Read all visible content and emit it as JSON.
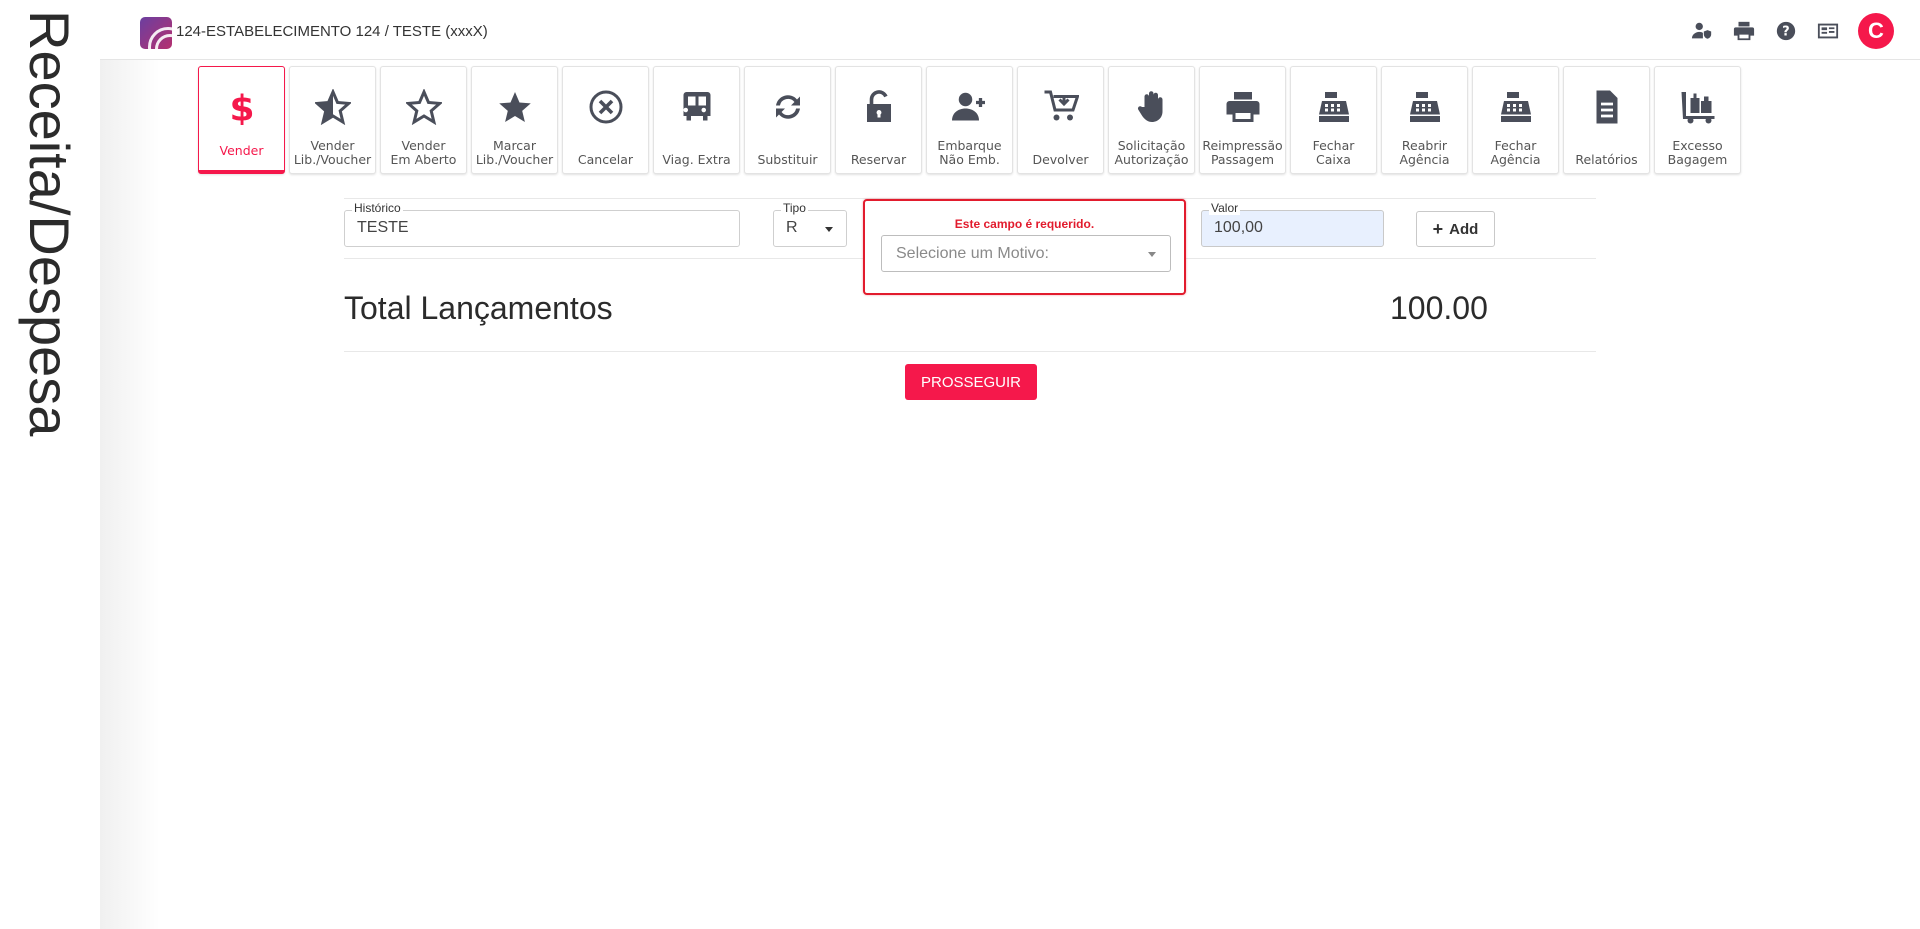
{
  "page": {
    "side_title": "Receita/Despesa"
  },
  "header": {
    "title": "124-ESTABELECIMENTO 124 / TESTE (xxxX)",
    "icons": [
      "user-shield-icon",
      "printer-icon",
      "help-icon",
      "cash-register-icon"
    ],
    "avatar_letter": "C",
    "accent_color": "#f5184b"
  },
  "toolbar": {
    "items": [
      {
        "label": "Vender",
        "icon": "dollar-icon",
        "active": true
      },
      {
        "label": "Vender\nLib./Voucher",
        "icon": "star-half-icon"
      },
      {
        "label": "Vender\nEm Aberto",
        "icon": "star-outline-icon"
      },
      {
        "label": "Marcar\nLib./Voucher",
        "icon": "star-icon"
      },
      {
        "label": "Cancelar",
        "icon": "cancel-circle-icon"
      },
      {
        "label": "Viag. Extra",
        "icon": "bus-icon"
      },
      {
        "label": "Substituir",
        "icon": "sync-icon"
      },
      {
        "label": "Reservar",
        "icon": "unlock-icon"
      },
      {
        "label": "Embarque\nNão Emb.",
        "icon": "user-plus-icon"
      },
      {
        "label": "Devolver",
        "icon": "cart-return-icon"
      },
      {
        "label": "Solicitação\nAutorização",
        "icon": "hand-icon"
      },
      {
        "label": "Reimpressão\nPassagem",
        "icon": "printer-icon"
      },
      {
        "label": "Fechar\nCaixa",
        "icon": "cash-register-icon"
      },
      {
        "label": "Reabrir\nAgência",
        "icon": "cash-register-icon"
      },
      {
        "label": "Fechar\nAgência",
        "icon": "cash-register-icon"
      },
      {
        "label": "Relatórios",
        "icon": "file-icon"
      },
      {
        "label": "Excesso\nBagagem",
        "icon": "luggage-cart-icon"
      }
    ]
  },
  "form": {
    "historico": {
      "label": "Histórico",
      "value": "TESTE"
    },
    "tipo": {
      "label": "Tipo",
      "value": "R"
    },
    "motivo": {
      "error": "Este campo é requerido.",
      "placeholder": "Selecione um Motivo:"
    },
    "valor": {
      "label": "Valor",
      "value": "100,00"
    },
    "add_label": "Add"
  },
  "summary": {
    "total_label": "Total Lançamentos",
    "total_value": "100.00"
  },
  "actions": {
    "proceed_label": "PROSSEGUIR"
  }
}
